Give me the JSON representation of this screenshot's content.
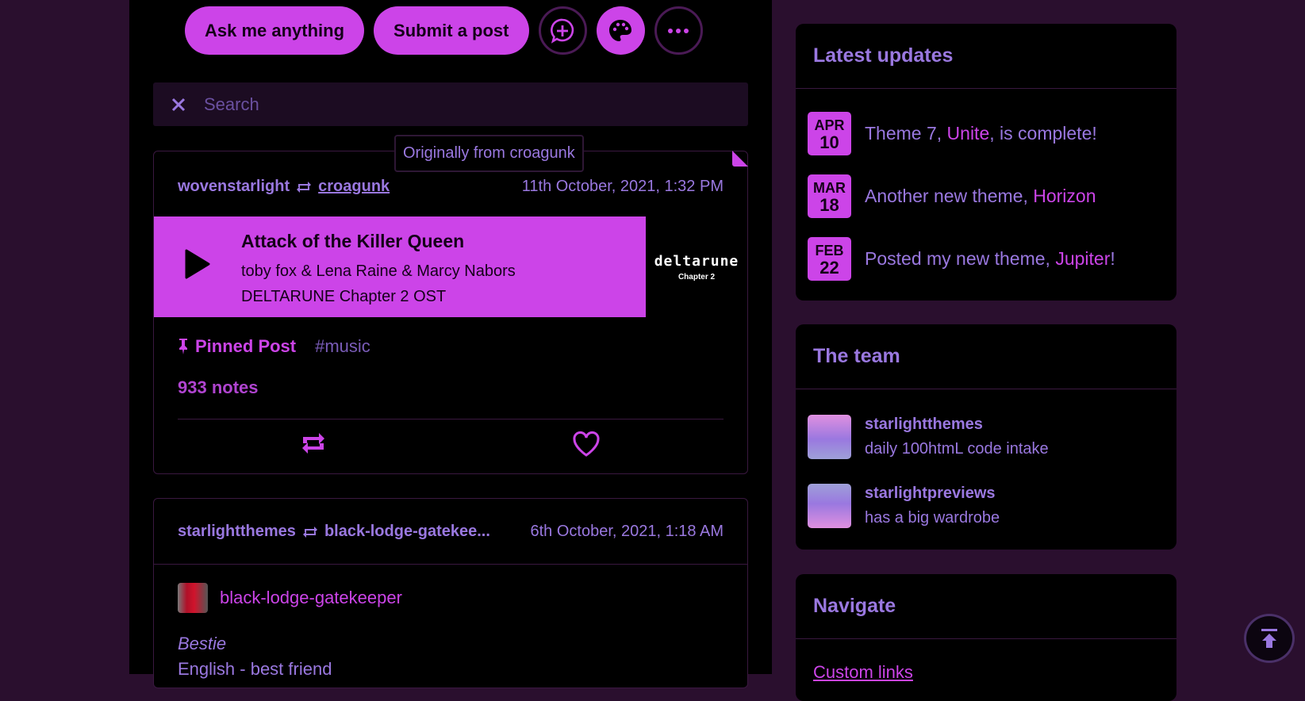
{
  "top_actions": {
    "ask_label": "Ask me anything",
    "submit_label": "Submit a post",
    "icons": [
      "new-message-icon",
      "palette-icon",
      "more-icon"
    ]
  },
  "search": {
    "placeholder": "Search",
    "value": ""
  },
  "posts": [
    {
      "tooltip": "Originally from croagunk",
      "user": "wovenstarlight",
      "source": "croagunk",
      "date": "11th October, 2021, 1:32 PM",
      "audio": {
        "title": "Attack of the Killer Queen",
        "artist": "toby fox & Lena Raine & Marcy Nabors",
        "album": "DELTARUNE Chapter 2 OST",
        "art_logo": "deltarune",
        "art_sub": "Chapter 2"
      },
      "pinned_label": "Pinned Post",
      "tag": "#music",
      "notes": "933 notes"
    },
    {
      "user": "starlightthemes",
      "source": "black-lodge-gatekee...",
      "date": "6th October, 2021, 1:18 AM",
      "reblog_user": "black-lodge-gatekeeper",
      "body_italic": "Bestie",
      "body_text": "English - best friend"
    }
  ],
  "sidebar": {
    "updates": {
      "title": "Latest updates",
      "items": [
        {
          "month": "APR",
          "day": "10",
          "pre": "Theme 7, ",
          "highlight": "Unite",
          "post": ", is complete!"
        },
        {
          "month": "MAR",
          "day": "18",
          "pre": "Another new theme, ",
          "highlight": "Horizon",
          "post": ""
        },
        {
          "month": "FEB",
          "day": "22",
          "pre": "Posted my new theme, ",
          "highlight": "Jupiter",
          "post": "!"
        }
      ]
    },
    "team": {
      "title": "The team",
      "members": [
        {
          "name": "starlightthemes",
          "bio": "daily 100htmL code intake"
        },
        {
          "name": "starlightpreviews",
          "bio": "has a big wardrobe"
        }
      ]
    },
    "navigate": {
      "title": "Navigate",
      "link": "Custom links"
    }
  },
  "colors": {
    "accent": "#cc44e8",
    "text": "#9a78e0",
    "page_bg": "#2a0f2e",
    "panel_bg": "#000000"
  }
}
